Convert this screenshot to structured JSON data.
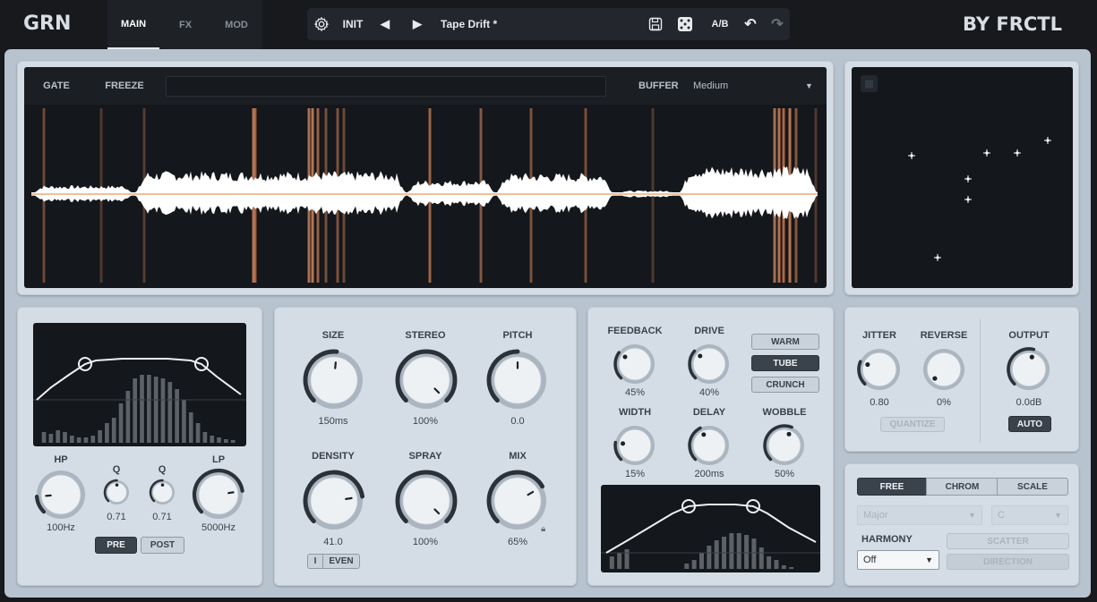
{
  "app": {
    "logo": "GRN",
    "brand": "BY FRCTL"
  },
  "tabs": [
    {
      "label": "MAIN"
    },
    {
      "label": "FX"
    },
    {
      "label": "MOD"
    }
  ],
  "preset": {
    "init": "INIT",
    "name": "Tape Drift *",
    "ab": "A/B"
  },
  "wave": {
    "gate": "GATE",
    "freeze": "FREEZE",
    "buffer_label": "BUFFER",
    "buffer_value": "Medium"
  },
  "eq": {
    "hp": {
      "label": "HP",
      "value": "100Hz",
      "level": 0.15
    },
    "q1": {
      "label": "Q",
      "value": "0.71",
      "level": 0.5
    },
    "q2": {
      "label": "Q",
      "value": "0.71",
      "level": 0.5
    },
    "lp": {
      "label": "LP",
      "value": "5000Hz",
      "level": 0.8
    },
    "pre": "PRE",
    "post": "POST"
  },
  "grain": {
    "size": {
      "label": "SIZE",
      "value": "150ms",
      "level": 0.52
    },
    "stereo": {
      "label": "STEREO",
      "value": "100%",
      "level": 1.0
    },
    "pitch": {
      "label": "PITCH",
      "value": "0.0",
      "level": 0.5
    },
    "density": {
      "label": "DENSITY",
      "value": "41.0",
      "level": 0.8
    },
    "spray": {
      "label": "SPRAY",
      "value": "100%",
      "level": 1.0
    },
    "mix": {
      "label": "MIX",
      "value": "65%",
      "level": 0.72
    },
    "mode_i": "I",
    "mode_even": "EVEN"
  },
  "fx": {
    "feedback": {
      "label": "FEEDBACK",
      "value": "45%",
      "level": 0.3
    },
    "drive": {
      "label": "DRIVE",
      "value": "40%",
      "level": 0.32
    },
    "width": {
      "label": "WIDTH",
      "value": "15%",
      "level": 0.2
    },
    "delay": {
      "label": "DELAY",
      "value": "200ms",
      "level": 0.4
    },
    "wobble": {
      "label": "WOBBLE",
      "value": "50%",
      "level": 0.58
    },
    "warm": "WARM",
    "tube": "TUBE",
    "crunch": "CRUNCH"
  },
  "mod": {
    "jitter": {
      "label": "JITTER",
      "value": "0.80",
      "level": 0.25
    },
    "reverse": {
      "label": "REVERSE",
      "value": "0%",
      "level": 0.0
    },
    "output": {
      "label": "OUTPUT",
      "value": "0.0dB",
      "level": 0.55
    },
    "quantize": "QUANTIZE",
    "auto": "AUTO"
  },
  "pitchmode": {
    "free": "FREE",
    "chrom": "CHROM",
    "scale": "SCALE",
    "scale_value": "Major",
    "key_value": "C",
    "harmony": "HARMONY",
    "harmony_value": "Off",
    "scatter": "SCATTER",
    "direction": "DIRECTION"
  },
  "colors": {
    "accent": "#e07a4a",
    "panel": "#d4dde5",
    "dark": "#14171b"
  }
}
